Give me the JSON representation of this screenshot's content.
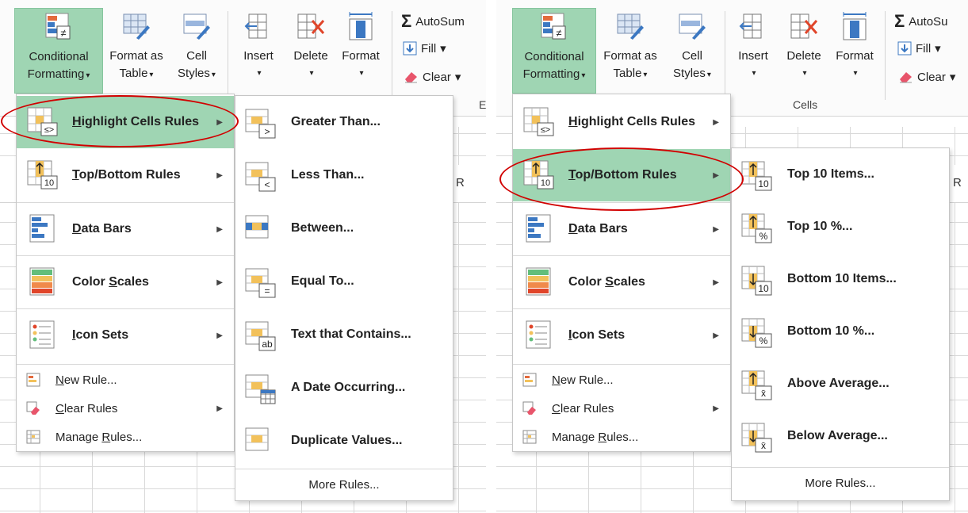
{
  "left": {
    "ribbon": {
      "cf_line1": "Conditional",
      "cf_line2": "Formatting",
      "fat_line1": "Format as",
      "fat_line2": "Table",
      "cs_line1": "Cell",
      "cs_line2": "Styles",
      "insert": "Insert",
      "delete": "Delete",
      "format": "Format",
      "autosum": "AutoSum",
      "fill": "Fill",
      "clear": "Clear",
      "group_fragment": "E",
      "column_letter": "R"
    },
    "menu": {
      "items": [
        {
          "label": "Highlight Cells Rules",
          "hotkey": "H",
          "active": true
        },
        {
          "label": "Top/Bottom Rules",
          "hotkey": "T"
        },
        {
          "label": "Data Bars",
          "hotkey": "D"
        },
        {
          "label": "Color Scales",
          "hotkey": "S"
        },
        {
          "label": "Icon Sets",
          "hotkey": "I"
        }
      ],
      "small": [
        {
          "label": "New Rule...",
          "hotkey": "N"
        },
        {
          "label": "Clear Rules",
          "hotkey": "C"
        },
        {
          "label": "Manage Rules...",
          "hotkey": "R"
        }
      ]
    },
    "submenu": {
      "items": [
        {
          "label": "Greater Than...",
          "badge": ">"
        },
        {
          "label": "Less Than...",
          "badge": "<"
        },
        {
          "label": "Between...",
          "badge": ""
        },
        {
          "label": "Equal To...",
          "badge": "="
        },
        {
          "label": "Text that Contains...",
          "badge": "ab"
        },
        {
          "label": "A Date Occurring...",
          "badge": ""
        },
        {
          "label": "Duplicate Values...",
          "badge": ""
        }
      ],
      "more": "More Rules..."
    }
  },
  "right": {
    "ribbon": {
      "cf_line1": "Conditional",
      "cf_line2": "Formatting",
      "fat_line1": "Format as",
      "fat_line2": "Table",
      "cs_line1": "Cell",
      "cs_line2": "Styles",
      "insert": "Insert",
      "delete": "Delete",
      "format": "Format",
      "autosum": "AutoSu",
      "fill": "Fill",
      "clear": "Clear",
      "cells_group": "Cells",
      "column_letter": "R"
    },
    "menu": {
      "items": [
        {
          "label": "Highlight Cells Rules"
        },
        {
          "label": "Top/Bottom Rules",
          "active": true
        },
        {
          "label": "Data Bars"
        },
        {
          "label": "Color Scales"
        },
        {
          "label": "Icon Sets"
        }
      ],
      "small": [
        {
          "label": "New Rule..."
        },
        {
          "label": "Clear Rules"
        },
        {
          "label": "Manage Rules..."
        }
      ]
    },
    "submenu": {
      "items": [
        {
          "label": "Top 10 Items...",
          "badge": "10"
        },
        {
          "label": "Top 10 %...",
          "badge": "%"
        },
        {
          "label": "Bottom 10 Items...",
          "badge": "10"
        },
        {
          "label": "Bottom 10 %...",
          "badge": "%"
        },
        {
          "label": "Above Average...",
          "badge": "x̄"
        },
        {
          "label": "Below Average...",
          "badge": "x̄"
        }
      ],
      "more": "More Rules..."
    }
  },
  "colors": {
    "highlight": "#9fd5b3",
    "oval": "#d10000",
    "icon_yellow": "#f2c15b",
    "icon_blue": "#3c78c2",
    "grid": "#d9d9d9"
  }
}
